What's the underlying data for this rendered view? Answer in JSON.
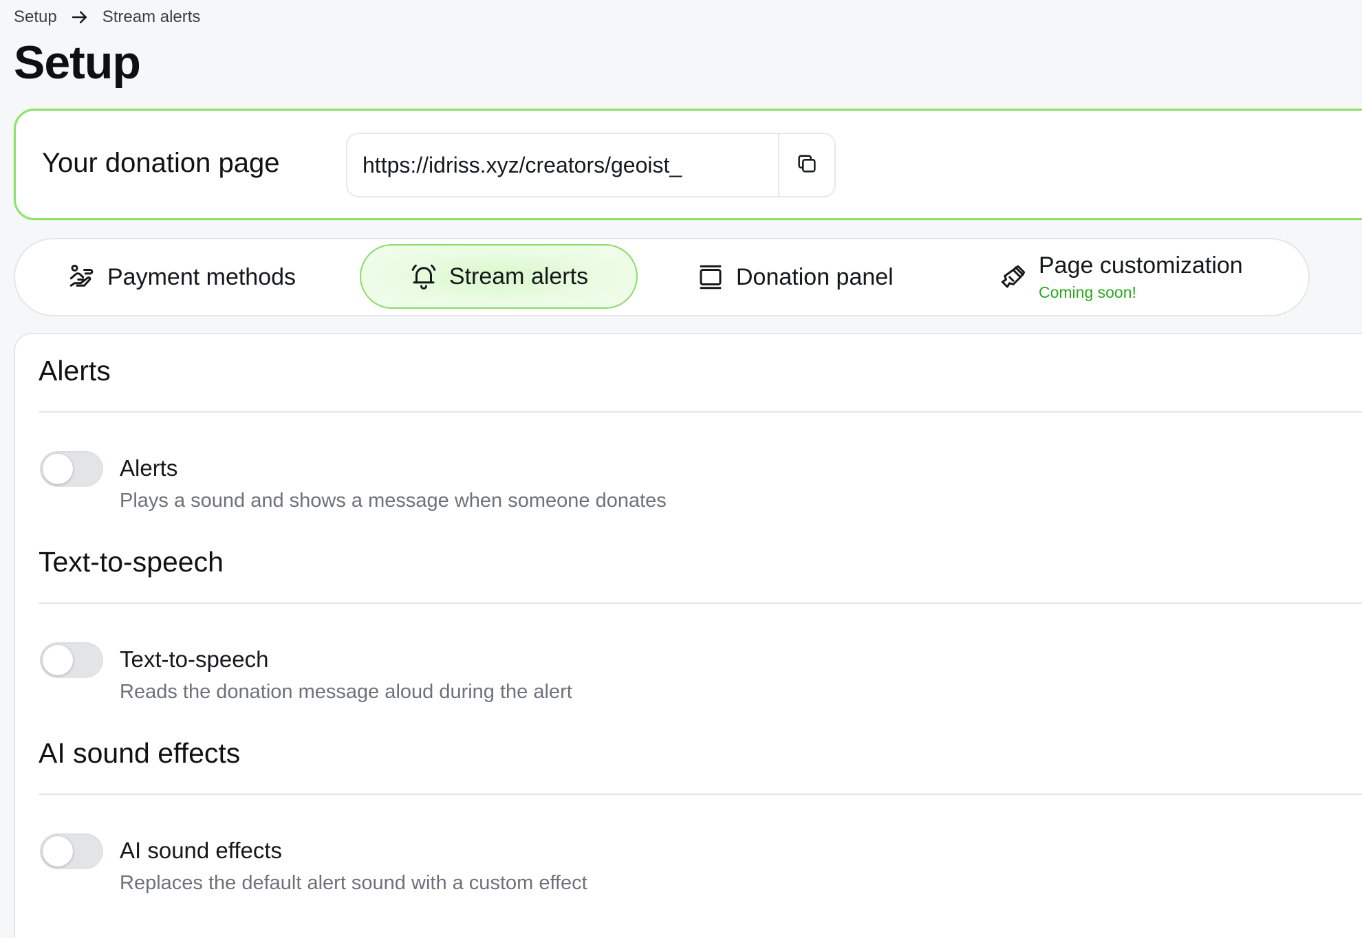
{
  "breadcrumb": {
    "root": "Setup",
    "current": "Stream alerts"
  },
  "page_title": "Setup",
  "donation_page": {
    "label": "Your donation page",
    "url": "https://idriss.xyz/creators/geoist_"
  },
  "tabs": [
    {
      "label": "Payment methods",
      "icon": "hand-coins-icon",
      "active": false
    },
    {
      "label": "Stream alerts",
      "icon": "bell-icon",
      "active": true
    },
    {
      "label": "Donation panel",
      "icon": "panel-icon",
      "active": false
    },
    {
      "label": "Page customization",
      "sublabel": "Coming soon!",
      "icon": "paintbrush-icon",
      "active": false
    }
  ],
  "sections": [
    {
      "title": "Alerts",
      "setting": {
        "name": "Alerts",
        "description": "Plays a sound and shows a message when someone donates",
        "enabled": false
      }
    },
    {
      "title": "Text-to-speech",
      "setting": {
        "name": "Text-to-speech",
        "description": "Reads the donation message aloud during the alert",
        "enabled": false
      }
    },
    {
      "title": "AI sound effects",
      "setting": {
        "name": "AI sound effects",
        "description": "Replaces the default alert sound with a custom effect",
        "enabled": false
      }
    }
  ],
  "colors": {
    "accent_border": "#8fe06c",
    "active_tab_fill": "#e4f9d9",
    "coming_soon": "#27a91c",
    "muted_text": "#6d717a"
  }
}
